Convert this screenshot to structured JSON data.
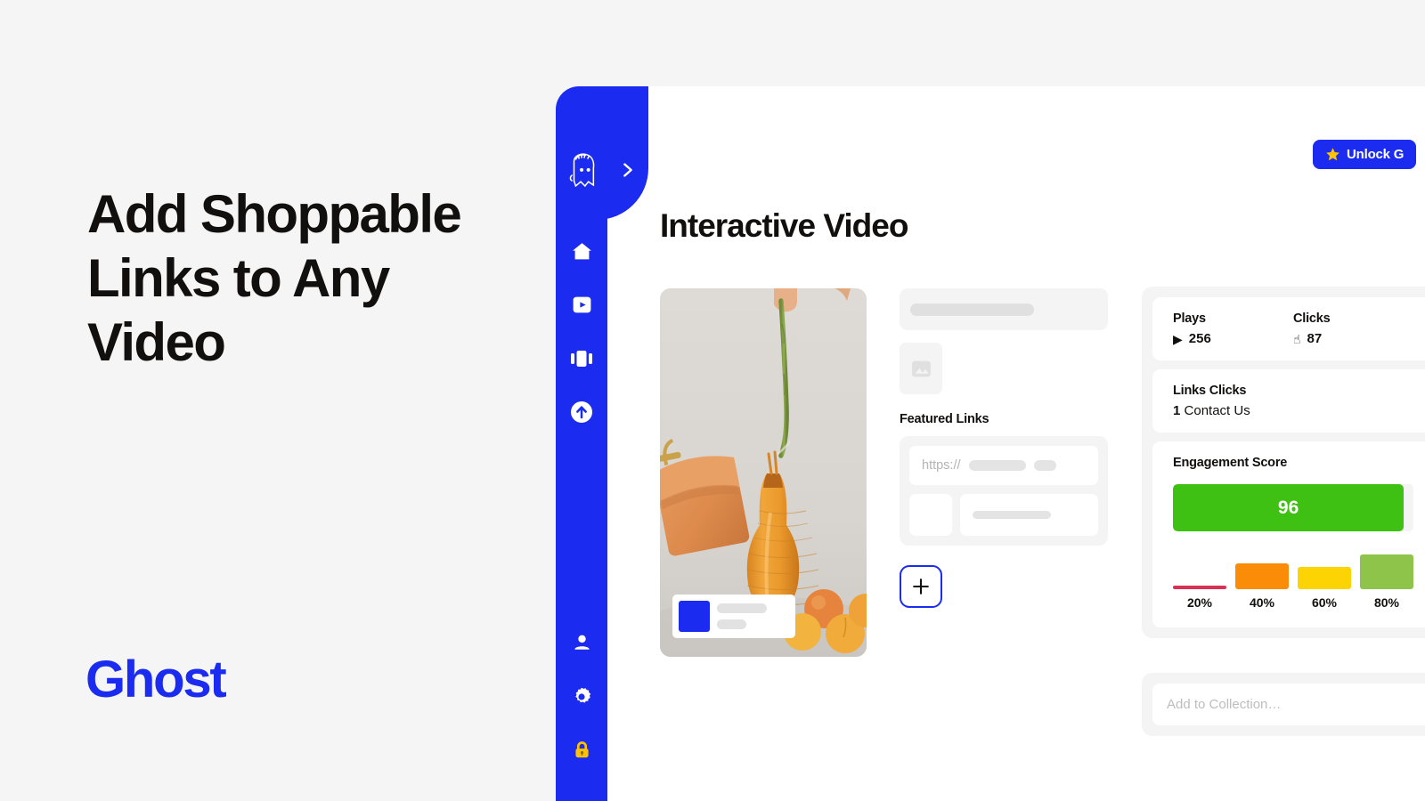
{
  "marketing": {
    "headline": "Add Shoppable Links to Any Video",
    "brand": "Ghost"
  },
  "sidebar": {
    "logo_icon": "ghost-logo-icon",
    "expand_icon": "chevron-right-icon",
    "items": [
      {
        "icon": "home-icon",
        "label": "Home"
      },
      {
        "icon": "video-play-icon",
        "label": "Videos"
      },
      {
        "icon": "carousel-icon",
        "label": "Carousels"
      },
      {
        "icon": "upload-circle-icon",
        "label": "Upload"
      }
    ],
    "bottom_items": [
      {
        "icon": "user-icon",
        "label": "Account"
      },
      {
        "icon": "gear-icon",
        "label": "Settings"
      },
      {
        "icon": "lock-icon",
        "label": "Locked"
      }
    ],
    "accent_color": "#1b2cf0",
    "lock_color": "#ffc200"
  },
  "header": {
    "unlock_button_label": "Unlock G",
    "unlock_button_icon": "star-icon",
    "page_title": "Interactive Video"
  },
  "video": {
    "overlay_card_name": "product-overlay-card"
  },
  "editor": {
    "featured_links_title": "Featured Links",
    "url_prefix": "https://",
    "add_link_icon": "plus-icon"
  },
  "stats": {
    "plays_label": "Plays",
    "plays_value": "256",
    "plays_icon": "play-triangle-icon",
    "clicks_label": "Clicks",
    "clicks_value": "87",
    "clicks_icon": "pointer-hand-icon",
    "links_clicks_label": "Links Clicks",
    "links_clicks_count": "1",
    "links_clicks_name": "Contact Us",
    "engagement_label": "Engagement Score",
    "engagement_score": "96"
  },
  "chart_data": {
    "type": "bar",
    "title": "Engagement Score",
    "categories": [
      "20%",
      "40%",
      "60%",
      "80%"
    ],
    "values": [
      6,
      42,
      36,
      56
    ],
    "colors": [
      "#d93055",
      "#fb8c08",
      "#fcd404",
      "#8fc44a"
    ],
    "ylim": [
      0,
      60
    ],
    "grid": false,
    "xlabel": "",
    "ylabel": ""
  },
  "collection": {
    "placeholder": "Add to Collection…"
  }
}
